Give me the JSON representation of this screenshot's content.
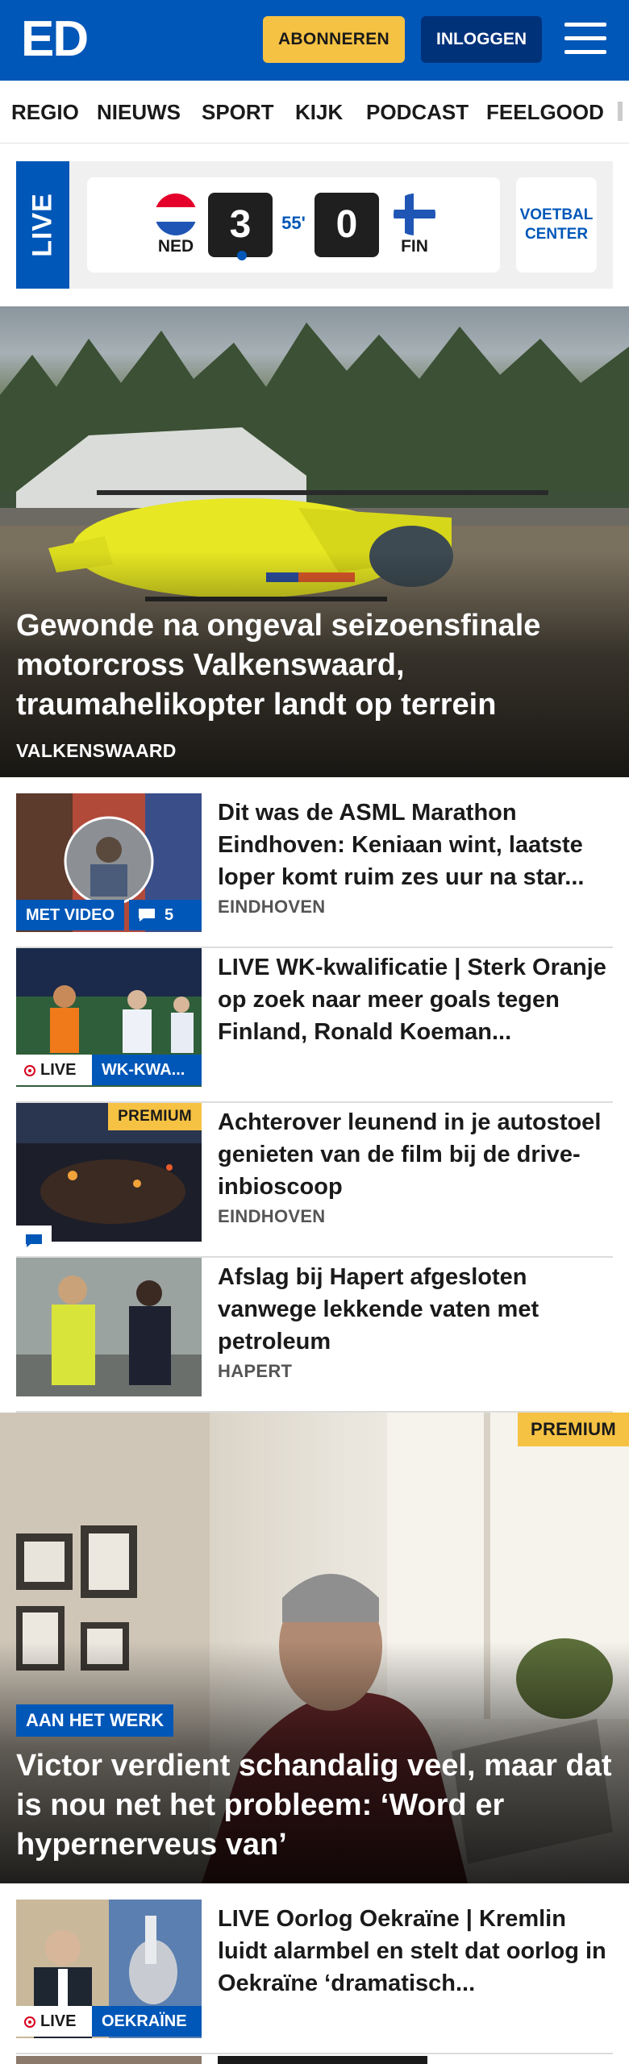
{
  "header": {
    "logo": "ED",
    "subscribe_label": "ABONNEREN",
    "login_label": "INLOGGEN",
    "menu_icon": "hamburger-menu-icon"
  },
  "nav": {
    "items": [
      "REGIO",
      "NIEUWS",
      "SPORT",
      "KIJK",
      "PODCAST",
      "FEELGOOD"
    ]
  },
  "live_widget": {
    "tag": "LIVE",
    "home": {
      "code": "NED",
      "score": "3"
    },
    "away": {
      "code": "FIN",
      "score": "0"
    },
    "minute": "55'",
    "center_line1": "VOETBAL",
    "center_line2": "CENTER"
  },
  "hero": {
    "title": "Gewonde na ongeval seizoensfinale motorcross Valkenswaard, traumahelikopter landt op terrein",
    "location": "VALKENSWAARD"
  },
  "articles": [
    {
      "title": "Dit was de ASML Marathon Eindhoven: Keniaan wint, laatste loper komt ruim zes uur na star...",
      "location": "EINDHOVEN",
      "video_badge": "MET VIDEO",
      "comments": "5"
    },
    {
      "title": "LIVE WK-kwalificatie | Sterk Oranje op zoek naar meer goals tegen Finland, Ronald Koeman...",
      "live_label": "LIVE",
      "category": "WK-KWA..."
    },
    {
      "title": "Achterover leunend in je autostoel genieten van de film bij de drive-inbioscoop",
      "location": "EINDHOVEN",
      "premium": "PREMIUM"
    },
    {
      "title": "Afslag bij Hapert afgesloten vanwege lekkende vaten met petroleum",
      "location": "HAPERT"
    }
  ],
  "feature": {
    "premium": "PREMIUM",
    "tag": "AAN HET WERK",
    "title": "Victor verdient schandalig veel, maar dat is nou net het probleem: ‘Word er hypernerveus van’"
  },
  "articles_bottom": [
    {
      "title": "LIVE Oorlog Oekraïne | Kremlin luidt alarmbel en stelt dat oorlog in Oekraïne ‘dramatisch...",
      "live_label": "LIVE",
      "category": "OEKRAÏNE"
    }
  ],
  "colors": {
    "brand_blue": "#0057b8",
    "subscribe_yellow": "#f6c243",
    "login_navy": "#00327a",
    "live_red": "#d8001c"
  }
}
